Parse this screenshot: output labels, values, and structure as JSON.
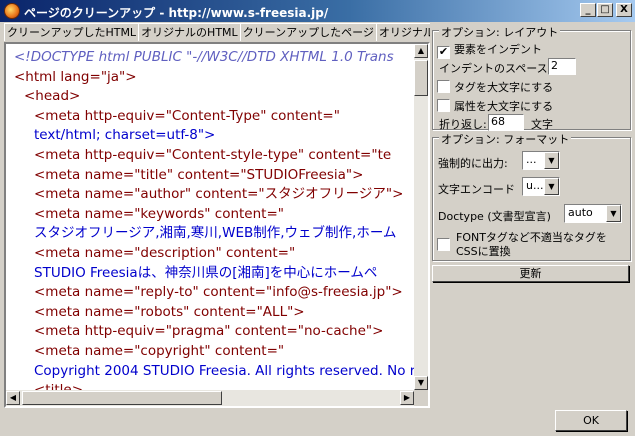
{
  "window": {
    "title": "ページのクリーンアップ - http://www.s-freesia.jp/",
    "minimize": "_",
    "maximize": "□",
    "close": "X"
  },
  "tabs": [
    "クリーンアップしたHTML",
    "オリジナルのHTML",
    "クリーンアップしたページ",
    "オリジナルのページ"
  ],
  "code_lines": [
    "<!DOCTYPE html PUBLIC \"-//W3C//DTD XHTML 1.0 Trans",
    "<html lang=\"ja\">",
    "<head>",
    "<meta http-equiv=\"Content-Type\" content=\"",
    "text/html; charset=utf-8\">",
    "<meta http-equiv=\"Content-style-type\" content=\"te",
    "<meta name=\"title\" content=\"STUDIOFreesia\">",
    "<meta name=\"author\" content=\"スタジオフリージア\">",
    "<meta name=\"keywords\" content=\"",
    "スタジオフリージア,湘南,寒川,WEB制作,ウェブ制作,ホーム",
    "<meta name=\"description\" content=\"",
    "STUDIO Freesiaは、神奈川県の[湘南]を中心にホームペ",
    "<meta name=\"reply-to\" content=\"info@s-freesia.jp\">",
    "<meta name=\"robots\" content=\"ALL\">",
    "<meta http-equiv=\"pragma\" content=\"no-cache\">",
    "<meta name=\"copyright\" content=\"",
    "Copyright 2004 STUDIO Freesia. All rights reserved. No r",
    "<title>"
  ],
  "layout_options": {
    "title": "オプション: レイアウト",
    "indent_elements": "要素をインデント",
    "indent_elements_checked": true,
    "indent_spaces_label": "インデントのスペース",
    "indent_spaces_value": "2",
    "uppercase_tags": "タグを大文字にする",
    "uppercase_tags_checked": false,
    "uppercase_attrs": "属性を大文字にする",
    "uppercase_attrs_checked": false,
    "wrap_label": "折り返し:",
    "wrap_value": "68",
    "wrap_unit": "文字"
  },
  "format_options": {
    "title": "オプション: フォーマット",
    "force_output_label": "強制的に出力:",
    "force_output_value": "...",
    "encoding_label": "文字エンコード",
    "encoding_value": "u...",
    "doctype_label": "Doctype (文書型宣言)",
    "doctype_value": "auto",
    "font_css": "FONTタグなど不適当なタグをCSSに置換",
    "font_css_checked": false
  },
  "update_button": "更新",
  "ok_button": "OK"
}
